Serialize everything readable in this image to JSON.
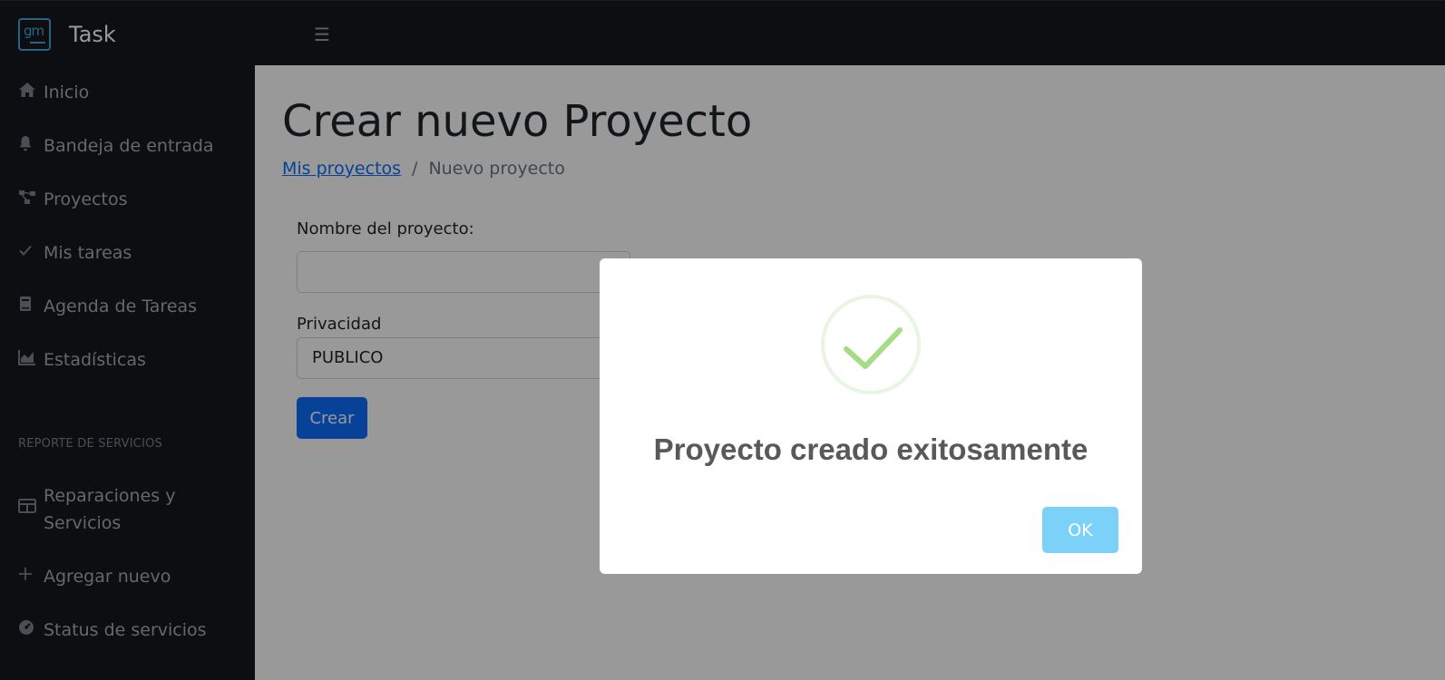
{
  "app": {
    "name": "Task",
    "logo_text": "gm"
  },
  "topbar": {
    "menu_icon": "hamburger-icon"
  },
  "sidebar": {
    "items": [
      {
        "label": "Inicio",
        "icon": "home-icon"
      },
      {
        "label": "Bandeja de entrada",
        "icon": "bell-icon"
      },
      {
        "label": "Proyectos",
        "icon": "diagram-icon"
      },
      {
        "label": "Mis tareas",
        "icon": "check-icon"
      },
      {
        "label": "Agenda de Tareas",
        "icon": "book-icon"
      },
      {
        "label": "Estadísticas",
        "icon": "chart-icon"
      }
    ],
    "section_title": "REPORTE DE SERVICIOS",
    "service_items": [
      {
        "label_line1": "Reparaciones y",
        "label_line2": "Servicios",
        "icon": "table-icon"
      },
      {
        "label": "Agregar nuevo",
        "icon": "plus-icon"
      },
      {
        "label": "Status de servicios",
        "icon": "gauge-icon"
      }
    ]
  },
  "main": {
    "title": "Crear nuevo Proyecto",
    "breadcrumb": {
      "link": "Mis proyectos",
      "separator": "/",
      "current": "Nuevo proyecto"
    },
    "form": {
      "name_label": "Nombre del proyecto:",
      "name_value": "",
      "privacy_label": "Privacidad",
      "privacy_value": "PUBLICO",
      "submit_label": "Crear"
    }
  },
  "modal": {
    "icon": "success-check-icon",
    "title": "Proyecto creado exitosamente",
    "ok_label": "OK"
  },
  "colors": {
    "primary": "#0d6efd",
    "sidebar_bg": "#16181d",
    "success_check": "#a5dc86",
    "ok_button": "#7cd1f9"
  }
}
